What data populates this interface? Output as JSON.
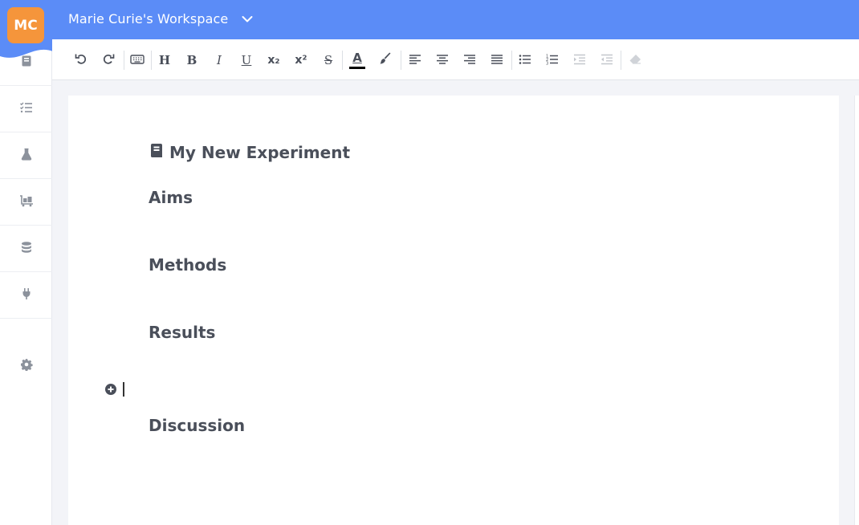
{
  "workspace": {
    "title": "Marie Curie's Workspace",
    "initials": "MC"
  },
  "colors": {
    "topbar": "#5b8cf7",
    "avatar": "#f5953b",
    "text": "#4a4f5a"
  },
  "sidebar": {
    "items": [
      {
        "name": "notebook-icon"
      },
      {
        "name": "task-list-icon"
      },
      {
        "name": "flask-icon"
      },
      {
        "name": "inventory-cart-icon"
      },
      {
        "name": "database-icon"
      },
      {
        "name": "plugin-icon"
      },
      {
        "name": "gear-icon"
      }
    ]
  },
  "toolbar": {
    "heading_label": "H",
    "bold_label": "B",
    "italic_label": "I",
    "underline_label": "U",
    "subscript_label": "x₂",
    "superscript_label": "x²",
    "strike_label": "S",
    "text_color_label": "A",
    "text_color": "#000000"
  },
  "document": {
    "title": "My New Experiment",
    "headings": [
      "Aims",
      "Methods",
      "Results",
      "Discussion"
    ]
  }
}
